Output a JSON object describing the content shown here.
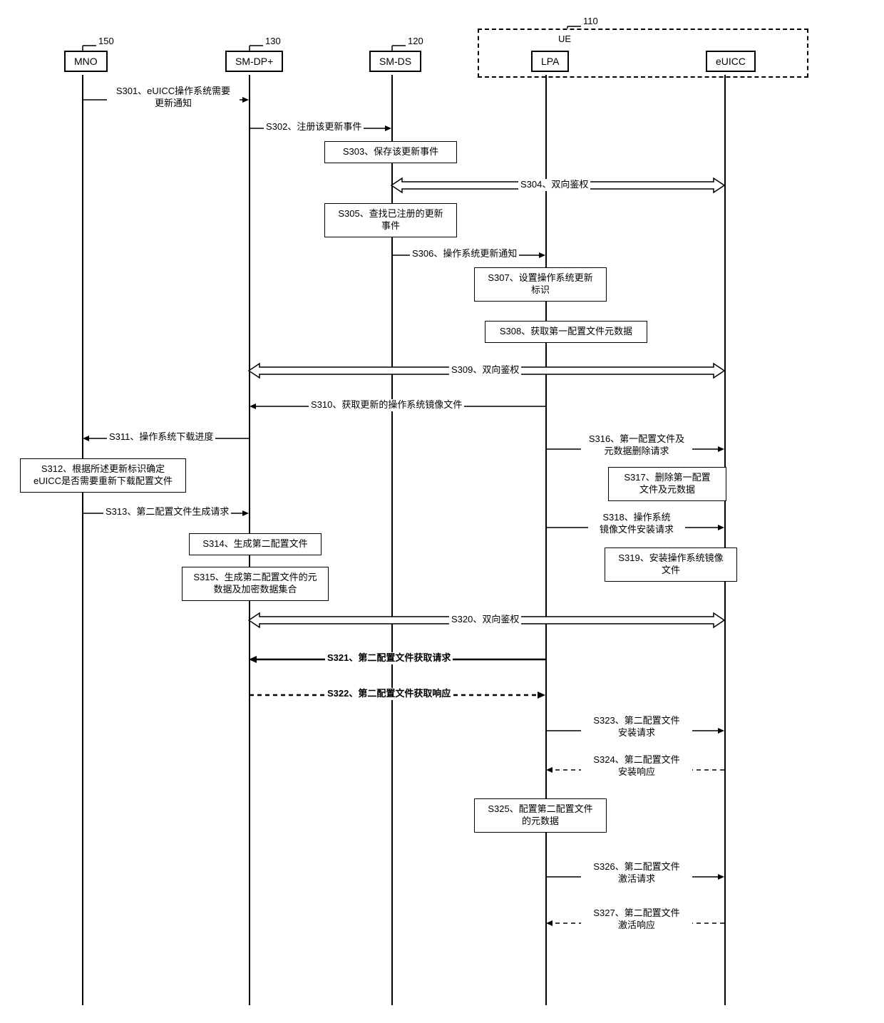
{
  "labels": {
    "id_150": "150",
    "id_130": "130",
    "id_120": "120",
    "id_110": "110"
  },
  "participants": {
    "mno": "MNO",
    "smdp": "SM-DP+",
    "smds": "SM-DS",
    "lpa": "LPA",
    "euicc": "eUICC",
    "ue": "UE"
  },
  "steps": {
    "s301_line1": "S301、eUICC操作系统需要",
    "s301_line2": "更新通知",
    "s302": "S302、注册该更新事件",
    "s303": "S303、保存该更新事件",
    "s304": "S304、双向鉴权",
    "s305_line1": "S305、查找已注册的更新",
    "s305_line2": "事件",
    "s306": "S306、操作系统更新通知",
    "s307_line1": "S307、设置操作系统更新",
    "s307_line2": "标识",
    "s308": "S308、获取第一配置文件元数据",
    "s309": "S309、双向鉴权",
    "s310": "S310、获取更新的操作系统镜像文件",
    "s311": "S311、操作系统下载进度",
    "s312_line1": "S312、根据所述更新标识确定",
    "s312_line2": "eUICC是否需要重新下载配置文件",
    "s313": "S313、第二配置文件生成请求",
    "s314": "S314、生成第二配置文件",
    "s315_line1": "S315、生成第二配置文件的元",
    "s315_line2": "数据及加密数据集合",
    "s316_line1": "S316、第一配置文件及",
    "s316_line2": "元数据删除请求",
    "s317_line1": "S317、删除第一配置",
    "s317_line2": "文件及元数据",
    "s318_line1": "S318、操作系统",
    "s318_line2": "镜像文件安装请求",
    "s319_line1": "S319、安装操作系统镜像",
    "s319_line2": "文件",
    "s320": "S320、双向鉴权",
    "s321": "S321、第二配置文件获取请求",
    "s322": "S322、第二配置文件获取响应",
    "s323_line1": "S323、第二配置文件",
    "s323_line2": "安装请求",
    "s324_line1": "S324、第二配置文件",
    "s324_line2": "安装响应",
    "s325_line1": "S325、配置第二配置文件",
    "s325_line2": "的元数据",
    "s326_line1": "S326、第二配置文件",
    "s326_line2": "激活请求",
    "s327_line1": "S327、第二配置文件",
    "s327_line2": "激活响应"
  }
}
